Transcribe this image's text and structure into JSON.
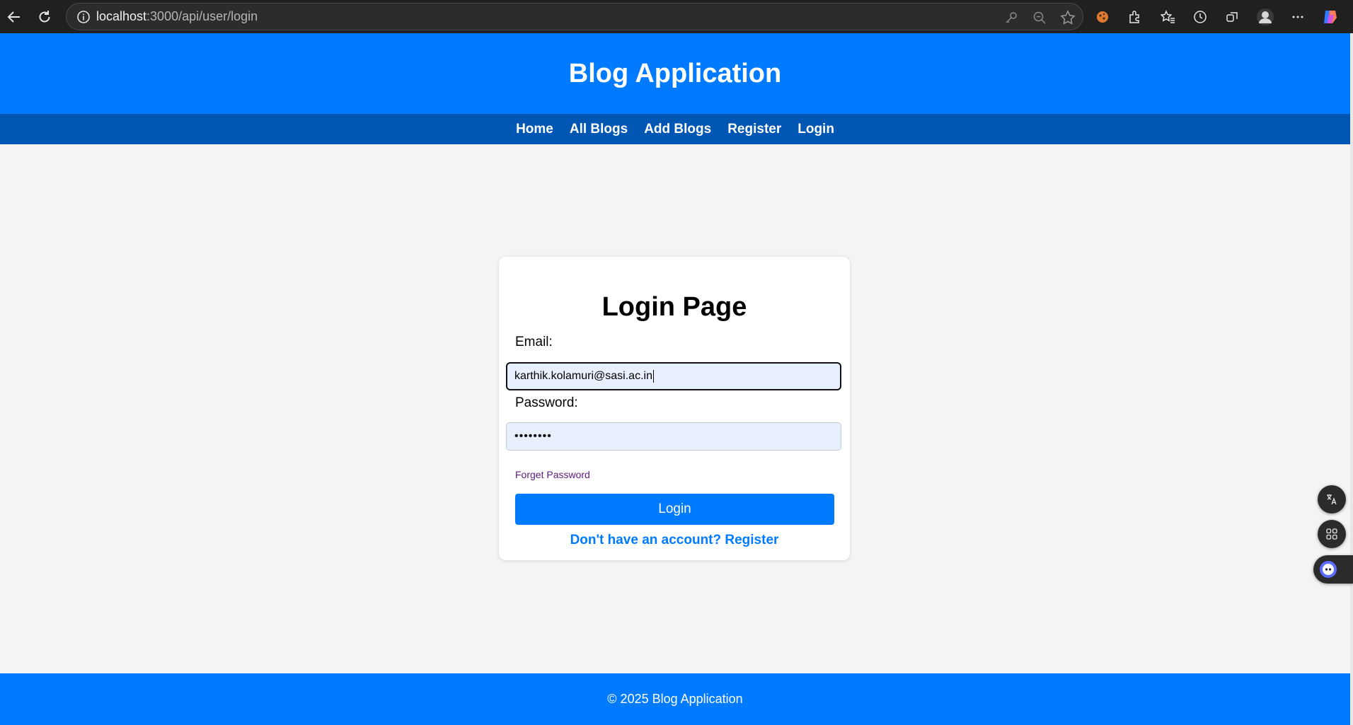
{
  "browser": {
    "url_host": "localhost",
    "url_rest": ":3000/api/user/login"
  },
  "site": {
    "title": "Blog Application",
    "nav": [
      {
        "label": "Home"
      },
      {
        "label": "All Blogs"
      },
      {
        "label": "Add Blogs"
      },
      {
        "label": "Register"
      },
      {
        "label": "Login"
      }
    ],
    "footer": "© 2025 Blog Application"
  },
  "login": {
    "heading": "Login Page",
    "email_label": "Email:",
    "email_value": "karthik.kolamuri@sasi.ac.in",
    "password_label": "Password:",
    "password_value": "••••••••",
    "forget_label": "Forget Password",
    "button_label": "Login",
    "register_prompt": "Don't have an account? Register"
  },
  "colors": {
    "header_bg": "#007bff",
    "nav_bg": "#0056b3",
    "link": "#007bff"
  }
}
